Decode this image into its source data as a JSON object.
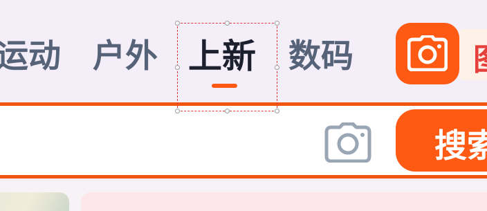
{
  "tabs": {
    "items": [
      {
        "label": "运动"
      },
      {
        "label": "户外"
      },
      {
        "label": "上新",
        "active": true
      },
      {
        "label": "数码"
      }
    ]
  },
  "camera_button": {
    "icon": "camera-icon"
  },
  "side_tag": {
    "label": "图"
  },
  "search": {
    "value": "",
    "camera_icon": "camera-icon",
    "button_label": "搜索"
  },
  "colors": {
    "accent": "#ff5a14",
    "tab_text": "#556278",
    "tab_active_text": "#1b1f2e",
    "selection_box": "#e0363b"
  }
}
